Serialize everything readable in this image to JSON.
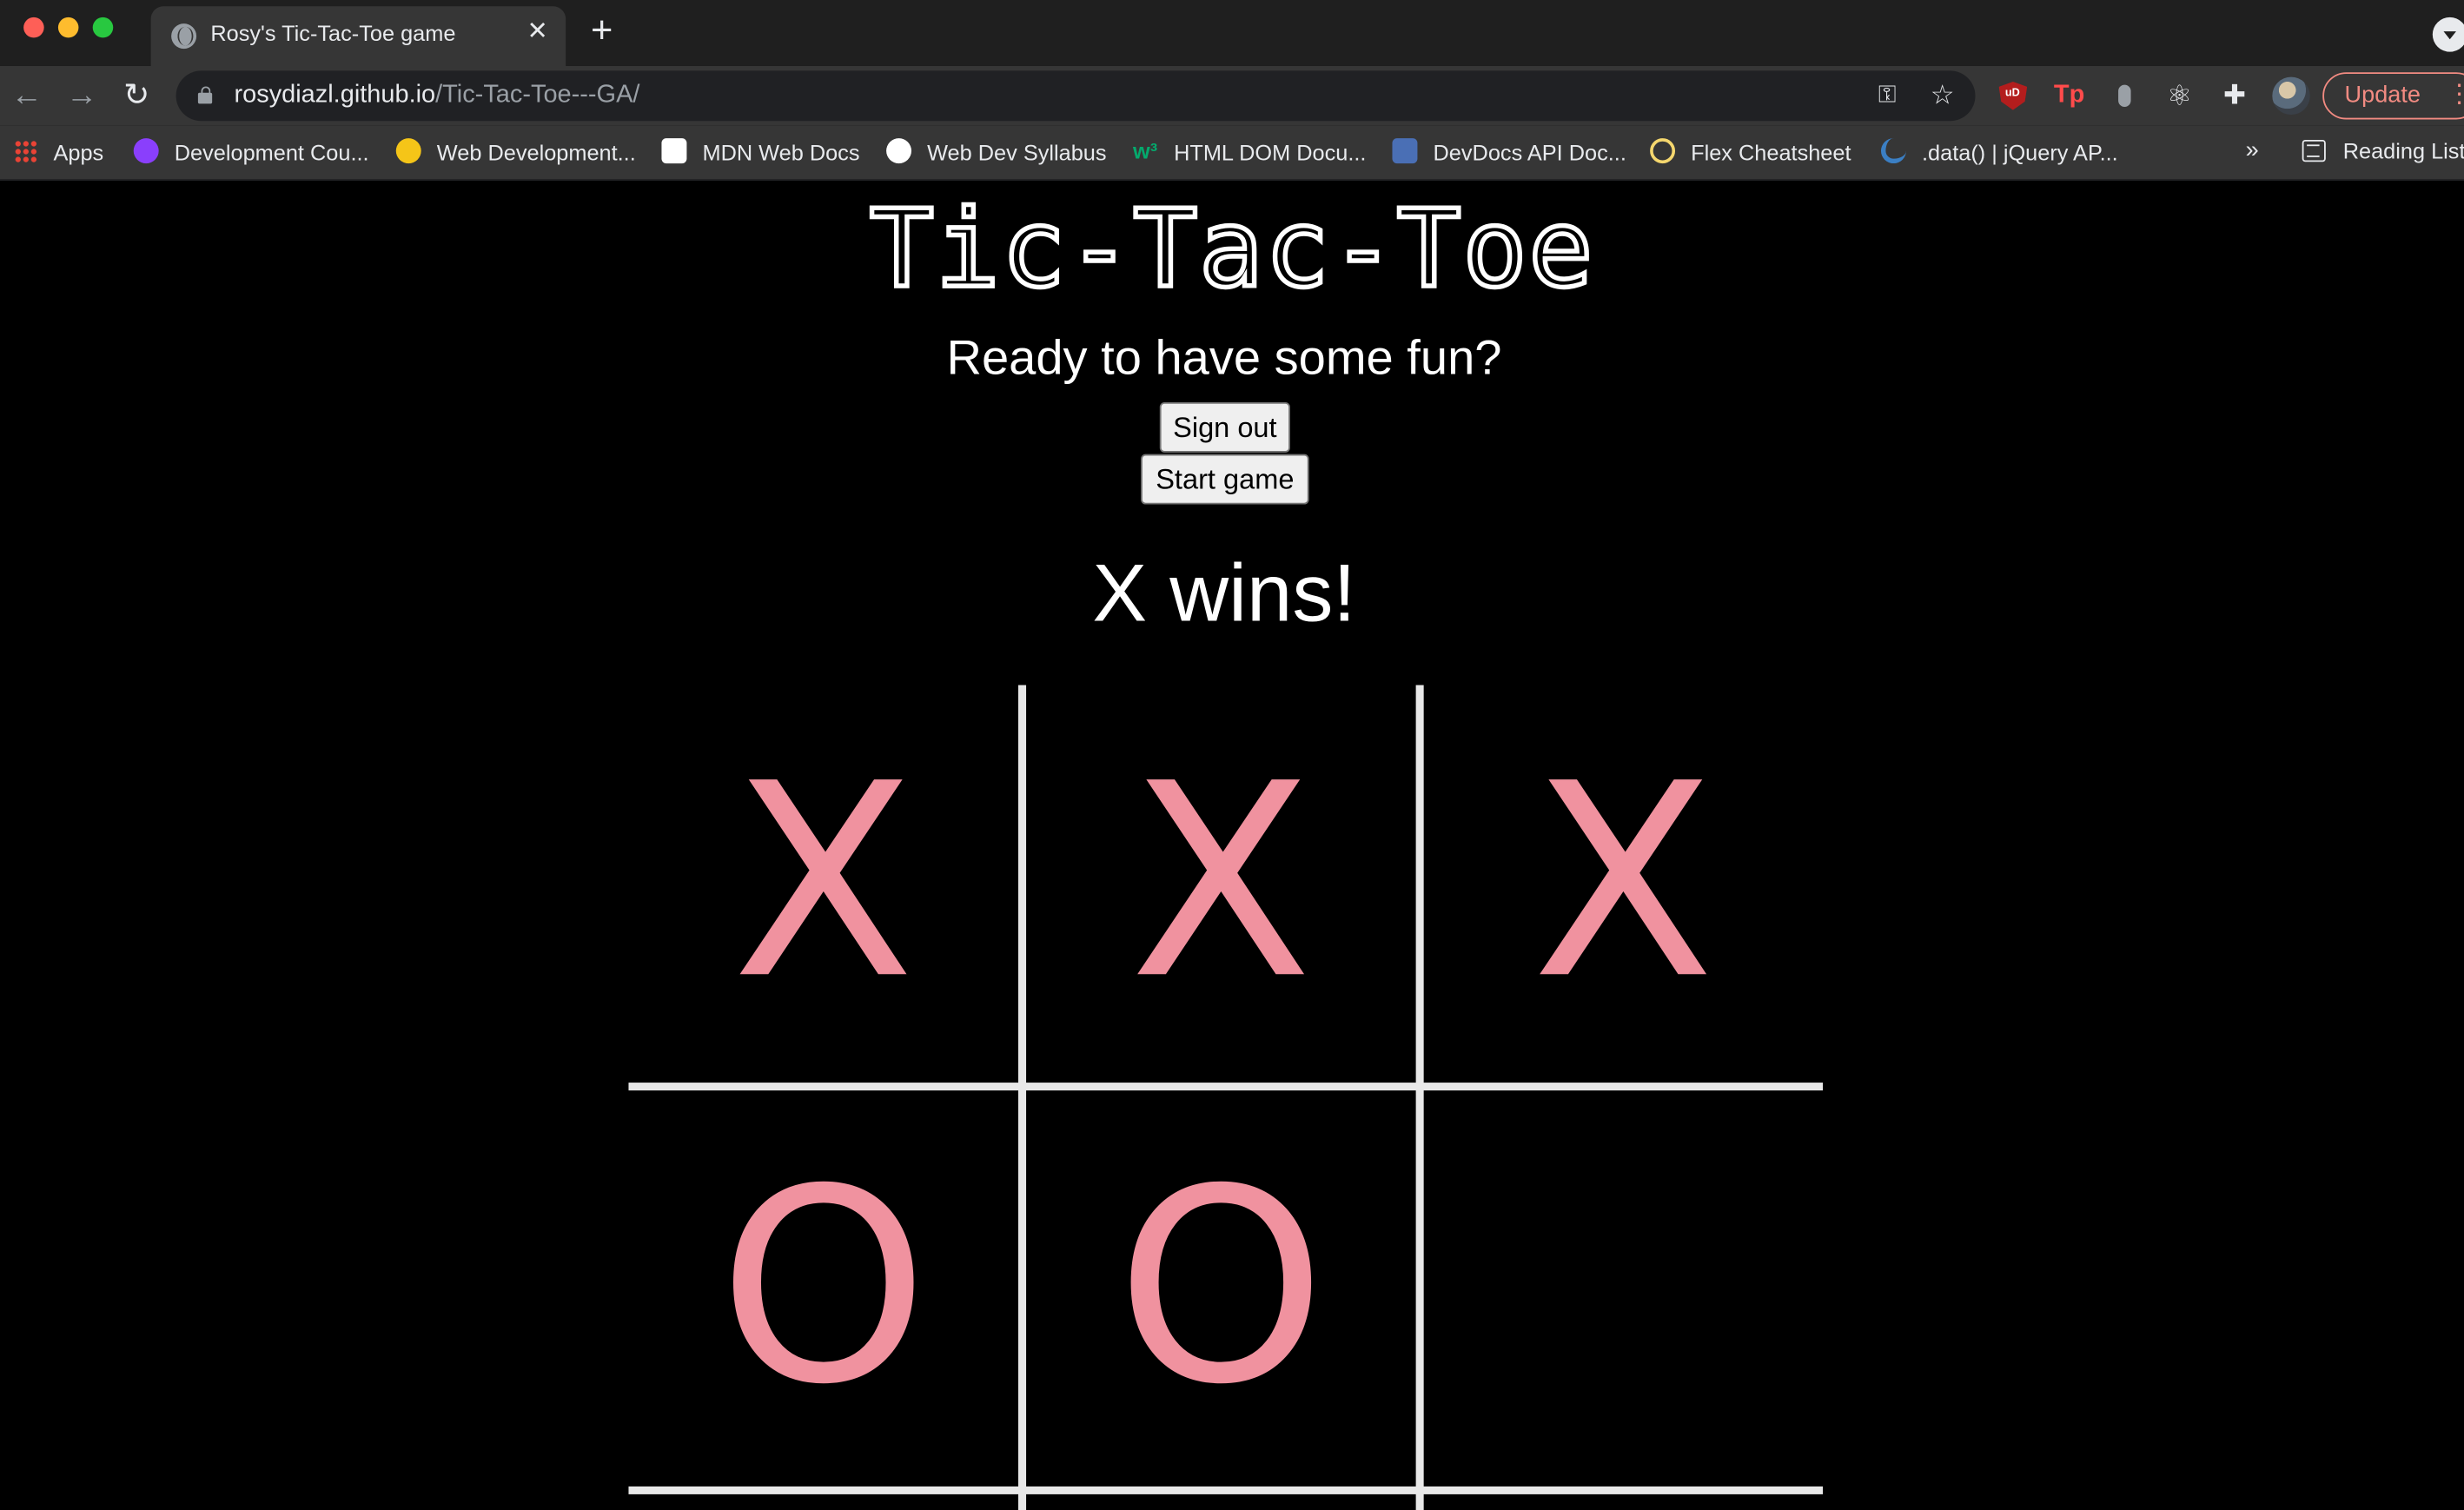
{
  "browser": {
    "tab_title": "Rosy's Tic-Tac-Toe game",
    "tab_close": "✕",
    "new_tab": "+",
    "url_host": "rosydiazl.github.io",
    "url_path": "/Tic-Tac-Toe---GA/",
    "update_label": "Update",
    "bookmarks": [
      {
        "label": "Apps",
        "icon": "apps-grid-icon"
      },
      {
        "label": "Development Cou...",
        "icon": "course-icon",
        "color": "#8a3ffc"
      },
      {
        "label": "Web Development...",
        "icon": "web-dev-icon",
        "color": "#f5c518"
      },
      {
        "label": "MDN Web Docs",
        "icon": "mdn-icon",
        "color": "#ffffff"
      },
      {
        "label": "Web Dev Syllabus",
        "icon": "globe-icon",
        "color": "#ffffff"
      },
      {
        "label": "HTML DOM Docu...",
        "icon": "w3schools-icon",
        "color": "#04aa6d"
      },
      {
        "label": "DevDocs API Doc...",
        "icon": "devdocs-icon",
        "color": "#4a6fb5"
      },
      {
        "label": "Flex Cheatsheet",
        "icon": "flex-icon",
        "color": "#f5d76e"
      },
      {
        "label": ".data() | jQuery AP...",
        "icon": "jquery-icon",
        "color": "#3b7fc4"
      }
    ],
    "bookmarks_more": "»",
    "reading_list": "Reading List"
  },
  "page": {
    "title": "Tic-Tac-Toe",
    "subtitle": "Ready to have some fun?",
    "sign_out_label": "Sign out",
    "start_game_label": "Start game",
    "status": "X wins!",
    "mark_color": "#f0929f",
    "board": [
      "X",
      "X",
      "X",
      "O",
      "O",
      ""
    ]
  }
}
